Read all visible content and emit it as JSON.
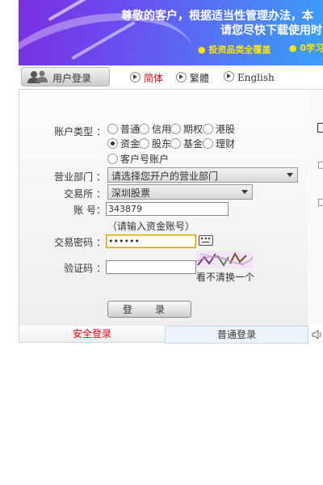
{
  "banner": {
    "line1": "尊敬的客户，根据适当性管理办法，本",
    "line2": "请您尽快下载使用时",
    "tag1": "● 投资品类全覆盖",
    "tag2": "● 0学习"
  },
  "nav": {
    "tab_label": "用户登录",
    "lang_simplified": "简体",
    "lang_traditional": "繁體",
    "lang_english": "English",
    "accent_color": "#e60012"
  },
  "form": {
    "account_type_label": "账户类型 ：",
    "account_types": [
      {
        "label": "普通",
        "selected": false
      },
      {
        "label": "信用",
        "selected": false
      },
      {
        "label": "期权",
        "selected": false
      },
      {
        "label": "港股",
        "selected": false
      },
      {
        "label": "资金",
        "selected": true
      },
      {
        "label": "股东",
        "selected": false
      },
      {
        "label": "基金",
        "selected": false
      },
      {
        "label": "理财",
        "selected": false
      },
      {
        "label": "客户号账户",
        "selected": false
      }
    ],
    "branch_label": "营业部门 ：",
    "branch_value": "请选择您开户的营业部门",
    "market_label": "交易所 ：",
    "market_value": "深圳股票",
    "account_label": "账 号：",
    "account_value": "343879",
    "account_hint": "（请输入资金账号）",
    "password_label": "交易密码 ：",
    "password_value": "••••••",
    "captcha_label": "验证码 ：",
    "captcha_value": "",
    "captcha_hint": "看不清换一个",
    "login_button": "登录"
  },
  "bottom_tabs": {
    "active": "安全登录",
    "inactive": "普通登录"
  }
}
